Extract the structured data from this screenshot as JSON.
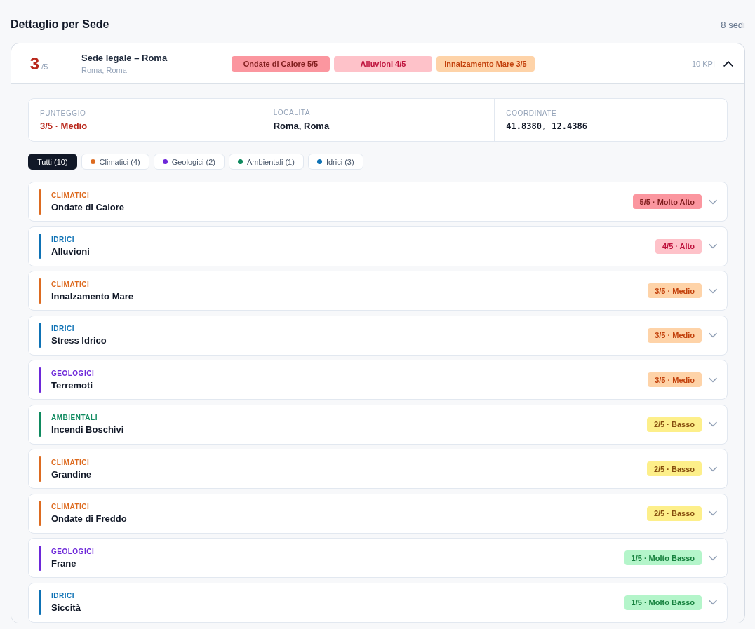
{
  "section": {
    "title": "Dettaglio per Sede",
    "count": "8 sedi"
  },
  "site": {
    "score": "3",
    "score_max": "/5",
    "name": "Sede legale – Roma",
    "location": "Roma, Roma",
    "expanded": true,
    "kpi_count": "10 KPI",
    "tags": [
      {
        "label": "Ondate di Calore 5/5",
        "kind": "critical"
      },
      {
        "label": "Alluvioni 4/5",
        "kind": "high"
      },
      {
        "label": "Innalzamento Mare 3/5",
        "kind": "medium"
      }
    ],
    "info": [
      {
        "label": "PUNTEGGIO",
        "value": "3/5 · Medio",
        "kind": "score"
      },
      {
        "label": "LOCALITA",
        "value": "Roma, Roma",
        "kind": "text"
      },
      {
        "label": "COORDINATE",
        "value": "41.8380, 12.4386",
        "kind": "mono"
      }
    ],
    "filters": [
      {
        "label": "Tutti (10)",
        "selected": true
      },
      {
        "label": "Climatici (4)",
        "color": "#dd6b20",
        "selected": false
      },
      {
        "label": "Geologici (2)",
        "color": "#6d28d9",
        "selected": false
      },
      {
        "label": "Ambientali (1)",
        "color": "#0f8a5f",
        "selected": false
      },
      {
        "label": "Idrici (3)",
        "color": "#0e72b5",
        "selected": false
      }
    ],
    "risks": [
      {
        "category": "CLIMATICI",
        "color": "#dd6b20",
        "name": "Ondate di Calore",
        "badge": "5/5 · Molto Alto",
        "kind": "critical",
        "expanded": false
      },
      {
        "category": "IDRICI",
        "color": "#0e72b5",
        "name": "Alluvioni",
        "badge": "4/5 · Alto",
        "kind": "high",
        "expanded": false
      },
      {
        "category": "CLIMATICI",
        "color": "#dd6b20",
        "name": "Innalzamento Mare",
        "badge": "3/5 · Medio",
        "kind": "medium",
        "expanded": false
      },
      {
        "category": "IDRICI",
        "color": "#0e72b5",
        "name": "Stress Idrico",
        "badge": "3/5 · Medio",
        "kind": "medium",
        "expanded": false
      },
      {
        "category": "GEOLOGICI",
        "color": "#6d28d9",
        "name": "Terremoti",
        "badge": "3/5 · Medio",
        "kind": "medium",
        "expanded": false
      },
      {
        "category": "AMBIENTALI",
        "color": "#0f8a5f",
        "name": "Incendi Boschivi",
        "badge": "2/5 · Basso",
        "kind": "low",
        "expanded": false
      },
      {
        "category": "CLIMATICI",
        "color": "#dd6b20",
        "name": "Grandine",
        "badge": "2/5 · Basso",
        "kind": "low",
        "expanded": false
      },
      {
        "category": "CLIMATICI",
        "color": "#dd6b20",
        "name": "Ondate di Freddo",
        "badge": "2/5 · Basso",
        "kind": "low",
        "expanded": false
      },
      {
        "category": "GEOLOGICI",
        "color": "#6d28d9",
        "name": "Frane",
        "badge": "1/5 · Molto Basso",
        "kind": "minimal",
        "expanded": false
      },
      {
        "category": "IDRICI",
        "color": "#0e72b5",
        "name": "Siccità",
        "badge": "1/5 · Molto Basso",
        "kind": "minimal",
        "expanded": false
      }
    ]
  }
}
